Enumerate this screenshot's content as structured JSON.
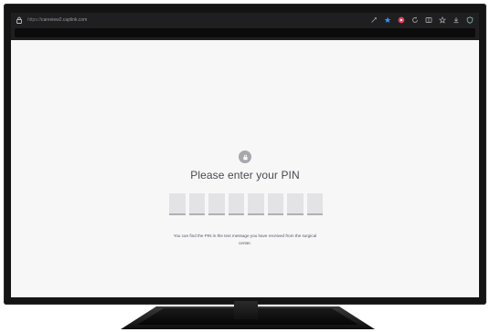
{
  "browser": {
    "url_scheme": "https://",
    "url_host": "careview2.caplink.com"
  },
  "toolbar_icons": [
    "extension-icon",
    "star-icon",
    "profile-icon",
    "refresh-icon",
    "sidebar-icon",
    "favorites-icon",
    "downloads-icon",
    "shield-icon"
  ],
  "page": {
    "title": "Please enter your PIN",
    "pin_length": 8,
    "help_text": "You can find the PIN in the text message you have received from the surgical center."
  },
  "colors": {
    "accent_star": "#3b8ef0",
    "accent_profile": "#e0405a"
  }
}
